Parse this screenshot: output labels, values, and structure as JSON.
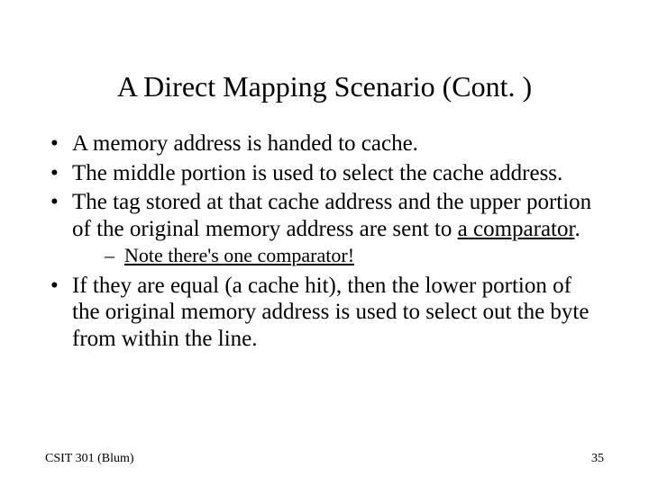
{
  "title": "A Direct Mapping Scenario (Cont. )",
  "bullets": {
    "b1": "A memory address is handed to cache.",
    "b2": "The middle portion is used to select the cache address.",
    "b3_pre": "The tag stored at that cache address and the upper portion of the original memory address are sent to ",
    "b3_underlined": "a comparator",
    "b3_post": ".",
    "sub1_pre": "Note there's ",
    "sub1_underlined": "one comparator!",
    "b4": "If they are equal (a cache hit), then the lower portion of the original memory address is used to select out the byte from within the line."
  },
  "footer": {
    "left": "CSIT 301 (Blum)",
    "right": "35"
  }
}
